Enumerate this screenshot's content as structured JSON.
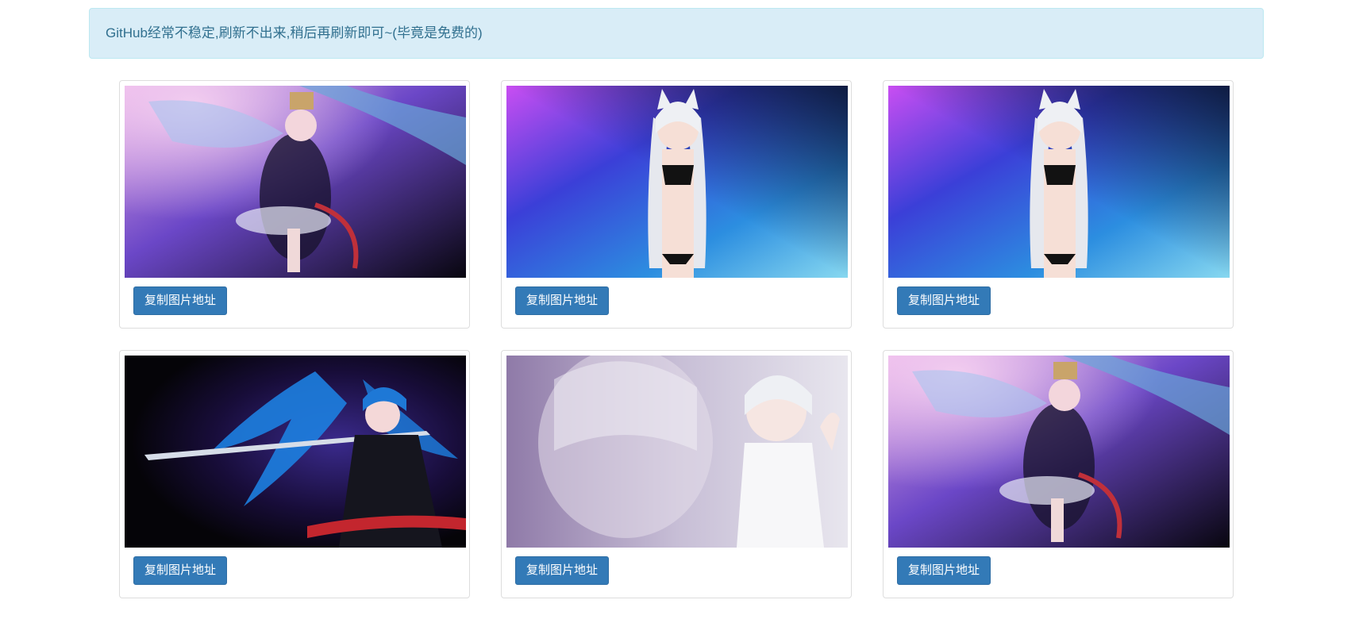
{
  "notice": {
    "text": "GitHub经常不稳定,刷新不出来,稍后再刷新即可~(毕竟是免费的)"
  },
  "cards": [
    {
      "image": "anime-girl-captain-hat-purple",
      "button_label": "复制图片地址"
    },
    {
      "image": "anime-girl-white-hair-cat-ears-blue",
      "button_label": "复制图片地址"
    },
    {
      "image": "anime-girl-white-hair-cat-ears-blue",
      "button_label": "复制图片地址"
    },
    {
      "image": "anime-girl-blue-hair-katana-dark",
      "button_label": "复制图片地址"
    },
    {
      "image": "anime-girl-silver-hair-lavender",
      "button_label": "复制图片地址"
    },
    {
      "image": "anime-girl-captain-hat-purple",
      "button_label": "复制图片地址"
    }
  ],
  "colors": {
    "alert_bg": "#d9edf7",
    "alert_text": "#31708f",
    "button_primary": "#337ab7"
  }
}
